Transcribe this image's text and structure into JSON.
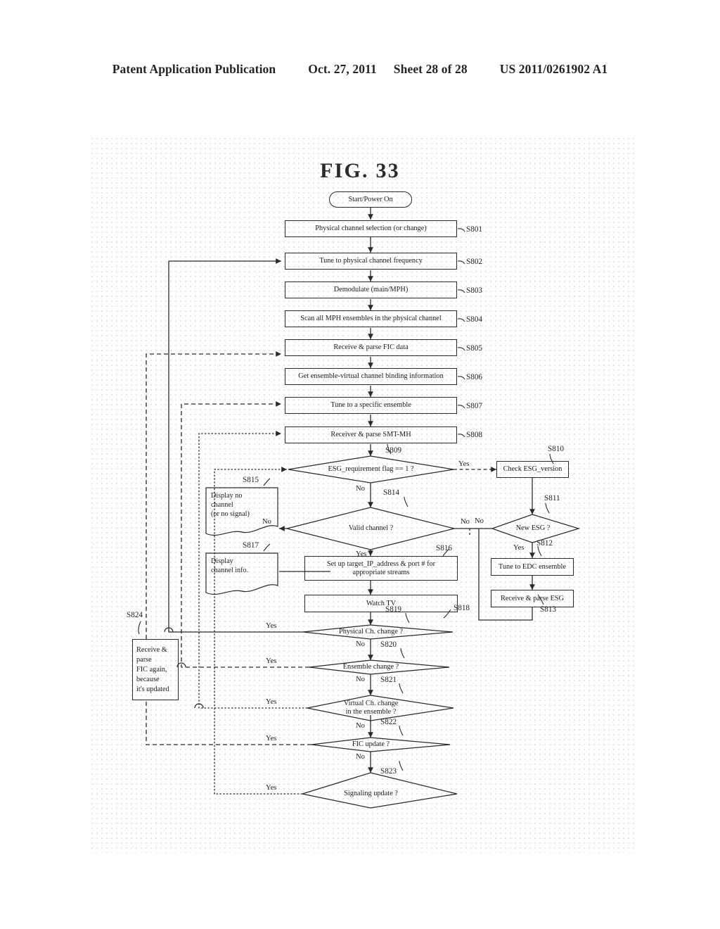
{
  "header": {
    "publication": "Patent Application Publication",
    "date": "Oct. 27, 2011",
    "sheet": "Sheet 28 of 28",
    "number": "US 2011/0261902 A1"
  },
  "figure": {
    "title": "FIG. 33",
    "type": "flowchart"
  },
  "nodes": {
    "start": {
      "label": "Start/Power On",
      "ref": ""
    },
    "s801": {
      "label": "Physical channel selection (or change)",
      "ref": "S801"
    },
    "s802": {
      "label": "Tune to physical channel frequency",
      "ref": "S802"
    },
    "s803": {
      "label": "Demodulate (main/MPH)",
      "ref": "S803"
    },
    "s804": {
      "label": "Scan all MPH ensembles in the physical channel",
      "ref": "S804"
    },
    "s805": {
      "label": "Receive & parse FIC data",
      "ref": "S805"
    },
    "s806": {
      "label": "Get ensemble-virtual channel binding information",
      "ref": "S806"
    },
    "s807": {
      "label": "Tune to a specific ensemble",
      "ref": "S807"
    },
    "s808": {
      "label": "Receiver & parse SMT-MH",
      "ref": "S808"
    },
    "s809": {
      "label": "ESG_requirement flag == 1 ?",
      "ref": "S809"
    },
    "s810": {
      "label": "Check ESG_version",
      "ref": "S810"
    },
    "s811": {
      "label": "New ESG ?",
      "ref": "S811"
    },
    "s812": {
      "label": "Tune to EDC ensemble",
      "ref": "S812"
    },
    "s813": {
      "label": "Receive & parse ESG",
      "ref": "S813"
    },
    "s814": {
      "label": "Valid channel ?",
      "ref": "S814"
    },
    "s815": {
      "line1": "Display no",
      "line2": "channel",
      "line3": "(or no signal)",
      "ref": "S815"
    },
    "s816": {
      "line1": "Set up target_IP_address & port # for",
      "line2": "appropriate streams",
      "ref": "S816"
    },
    "s817": {
      "line1": "Display",
      "line2": "channel info.",
      "ref": "S817"
    },
    "s818": {
      "label": "Watch TV",
      "ref": "S818"
    },
    "s819": {
      "label": "Physical Ch. change ?",
      "ref": "S819"
    },
    "s820": {
      "label": "Ensemble change ?",
      "ref": "S820"
    },
    "s821": {
      "line1": "Virtual Ch. change",
      "line2": "in the ensemble ?",
      "ref": "S821"
    },
    "s822": {
      "label": "FIC update ?",
      "ref": "S822"
    },
    "s823": {
      "label": "Signaling update ?",
      "ref": "S823"
    },
    "s824": {
      "line1": "Receive &",
      "line2": "parse",
      "line3": "FIC again,",
      "line4": "because",
      "line5": "it's updated",
      "ref": "S824"
    }
  },
  "branches": {
    "s809_yes": "Yes",
    "s809_no": "No",
    "s811_no": "No",
    "s811_yes": "Yes",
    "s814_no_left": "No",
    "s814_no_right": "No",
    "s814_yes": "Yes",
    "s819_yes": "Yes",
    "s819_no": "No",
    "s820_yes": "Yes",
    "s820_no": "No",
    "s821_yes": "Yes",
    "s821_no": "No",
    "s822_yes": "Yes",
    "s822_no": "No",
    "s823_yes": "Yes"
  },
  "colors": {
    "ink": "#2a2a2a",
    "paper": "#ffffff"
  }
}
